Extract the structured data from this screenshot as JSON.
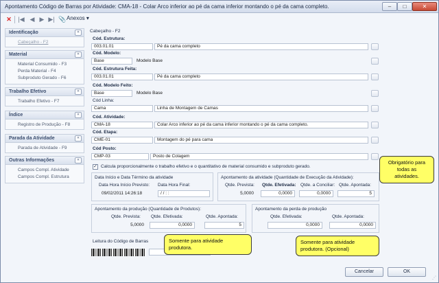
{
  "window": {
    "title": "Apontamento Código de Barras por Atividade: CMA-18 - Colar Arco inferior ao pé da cama inferior montando o pé da cama completo.",
    "minimize": "–",
    "maximize": "□",
    "close": "✕"
  },
  "toolbar": {
    "delete_icon": "✕",
    "first_icon": "|◀",
    "prev_icon": "◀",
    "next_icon": "▶",
    "last_icon": "▶|",
    "attach_icon": "📎",
    "anexos_label": "Anexos",
    "anexos_caret": "▾"
  },
  "sidebar": {
    "groups": [
      {
        "title": "Identificação",
        "items": [
          "Cabeçalho - F2"
        ]
      },
      {
        "title": "Material",
        "items": [
          "Material Consumido - F3",
          "Perda Material - F4",
          "Subproduto Gerado - F6"
        ]
      },
      {
        "title": "Trabalho Efetivo",
        "items": [
          "Trabalho Efetivo - F7"
        ]
      },
      {
        "title": "Índice",
        "items": [
          "Registro de Produção - F8"
        ]
      },
      {
        "title": "Parada da Atividade",
        "items": [
          "Parada de Atividade - F9"
        ]
      },
      {
        "title": "Outras Informações",
        "items": [
          "Campos Compl. Atividade",
          "Campos Compl. Estrutura"
        ]
      }
    ],
    "chevron": "«"
  },
  "main": {
    "section_title": "Cabeçalho - F2",
    "estrutura": {
      "label": "Cód. Estrutura:",
      "code": "003.01.01",
      "desc": "Pé da cama completo"
    },
    "modelo": {
      "label": "Cód. Modelo:",
      "code": "Base",
      "desc": "Modelo Base"
    },
    "estrutura_feita": {
      "label": "Cód. Estrutura Feita:",
      "code": "003.01.01",
      "desc": "Pé da cama completo"
    },
    "modelo_feito": {
      "label": "Cód. Modelo Feito:",
      "code": "Base",
      "desc": "Modelo Base"
    },
    "linha": {
      "label": "Cód Linha:",
      "code": "Cama",
      "desc": "Linha de Montagem de Camas"
    },
    "atividade": {
      "label": "Cód. Atividade:",
      "code": "CMA-18",
      "desc": "Colar Arco inferior ao pé da cama inferior montando o pé da cama completo."
    },
    "etapa": {
      "label": "Cód. Etapa:",
      "code": "CME-01",
      "desc": "Montagem do pé para cama"
    },
    "posto": {
      "label": "Cód Posto:",
      "code": "CMP-03",
      "desc": "Posto de Colagem"
    },
    "calc_checkbox": {
      "checked": "✓",
      "label": "Calcula proporcionalmente o trabalho efetivo e o quantitativo de material consumido e subproduto gerado."
    },
    "datas": {
      "title": "Data Início e Data Término da atividade",
      "inicio_label": "Data Hora Início Previsto:",
      "inicio_value": "09/02/2011 14:26:18",
      "final_label": "Data Hora Final:",
      "final_value": "/ /     : :"
    },
    "apont_atividade": {
      "title": "Apontamento da atividade (Quantidade de Execução da Atividade):",
      "prevista_label": "Qtde. Prevista:",
      "prevista_value": "5,0000",
      "efetivada_label": "Qtde. Efetivada:",
      "efetivada_value": "0,0000",
      "conciliar_label": "Qtde. a Conciliar:",
      "conciliar_value": "0,0000",
      "apontada_label": "Qtde. Apontada:",
      "apontada_value": "5"
    },
    "apont_producao": {
      "title": "Apontamento da produção (Quantidade de Produtos):",
      "prevista_label": "Qtde. Prevista:",
      "prevista_value": "5,0000",
      "efetivada_label": "Qtde. Efetivada:",
      "efetivada_value": "0,0000",
      "apontada_label": "Qtde. Apontada:",
      "apontada_value": "5"
    },
    "apont_perda": {
      "title": "Apontamento da perda de produção",
      "efetivada_label": "Qtde. Efetivada:",
      "efetivada_value": "0,0000",
      "apontada_label": "Qtde. Apontada:",
      "apontada_value": "0,0000"
    },
    "barcode_label": "Leitura do Código de Barras"
  },
  "callouts": {
    "obrigatorio": "Obrigatório para todas as atividades.",
    "somente": "Somente para atividade produtora.",
    "somente_opcional": "Somente para atividade produtora. (Opcional)"
  },
  "footer": {
    "cancel": "Cancelar",
    "ok": "OK",
    "grip": "⋰"
  },
  "colors": {
    "callout": "#ffff66",
    "accent": "#3b4d6e",
    "close_button": "#c74a34"
  }
}
